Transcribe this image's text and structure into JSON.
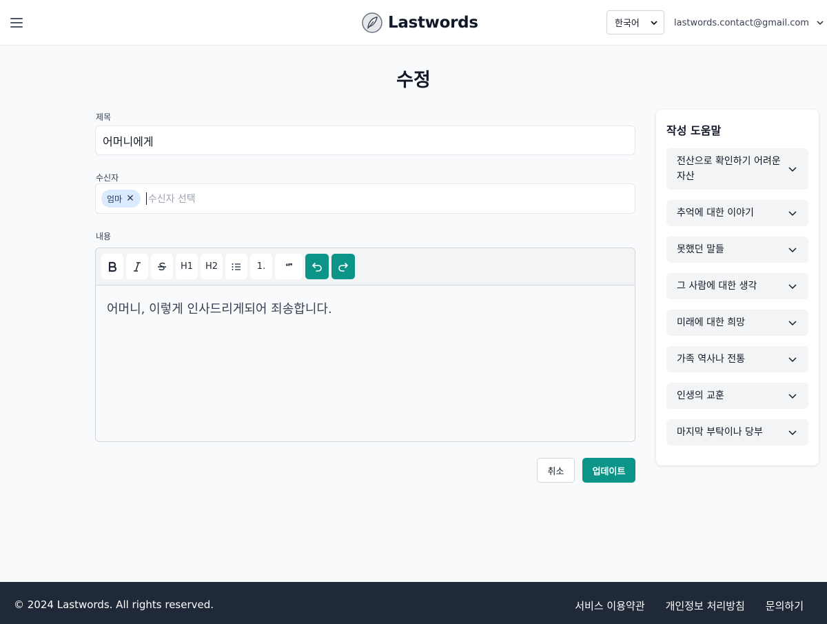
{
  "header": {
    "brand": "Lastwords",
    "language": "한국어",
    "account_email": "lastwords.contact@gmail.com"
  },
  "page": {
    "title": "수정"
  },
  "form": {
    "title_label": "제목",
    "title_value": "어머니에게",
    "recipient_label": "수신자",
    "recipients": [
      "엄마"
    ],
    "recipient_placeholder": "수신자 선택",
    "content_label": "내용",
    "content_value": "어머니, 이렇게 인사드리게되어 죄송합니다.",
    "cancel_label": "취소",
    "update_label": "업데이트"
  },
  "toolbar": {
    "h1": "H1",
    "h2": "H2",
    "ordered_list": "1.",
    "quote": "❝❞"
  },
  "help": {
    "title": "작성 도움말",
    "items": [
      "전산으로 확인하기 어려운 자산",
      "추억에 대한 이야기",
      "못했던 말들",
      "그 사람에 대한 생각",
      "미래에 대한 희망",
      "가족 역사나 전통",
      "인생의 교훈",
      "마지막 부탁이나 당부"
    ]
  },
  "footer": {
    "copyright": "© 2024 Lastwords. All rights reserved.",
    "terms": "서비스 이용약관",
    "privacy": "개인정보 처리방침",
    "contact": "문의하기"
  },
  "colors": {
    "accent": "#0d9488",
    "footer_bg": "#1f2937",
    "chip_bg": "#dbeafe"
  }
}
